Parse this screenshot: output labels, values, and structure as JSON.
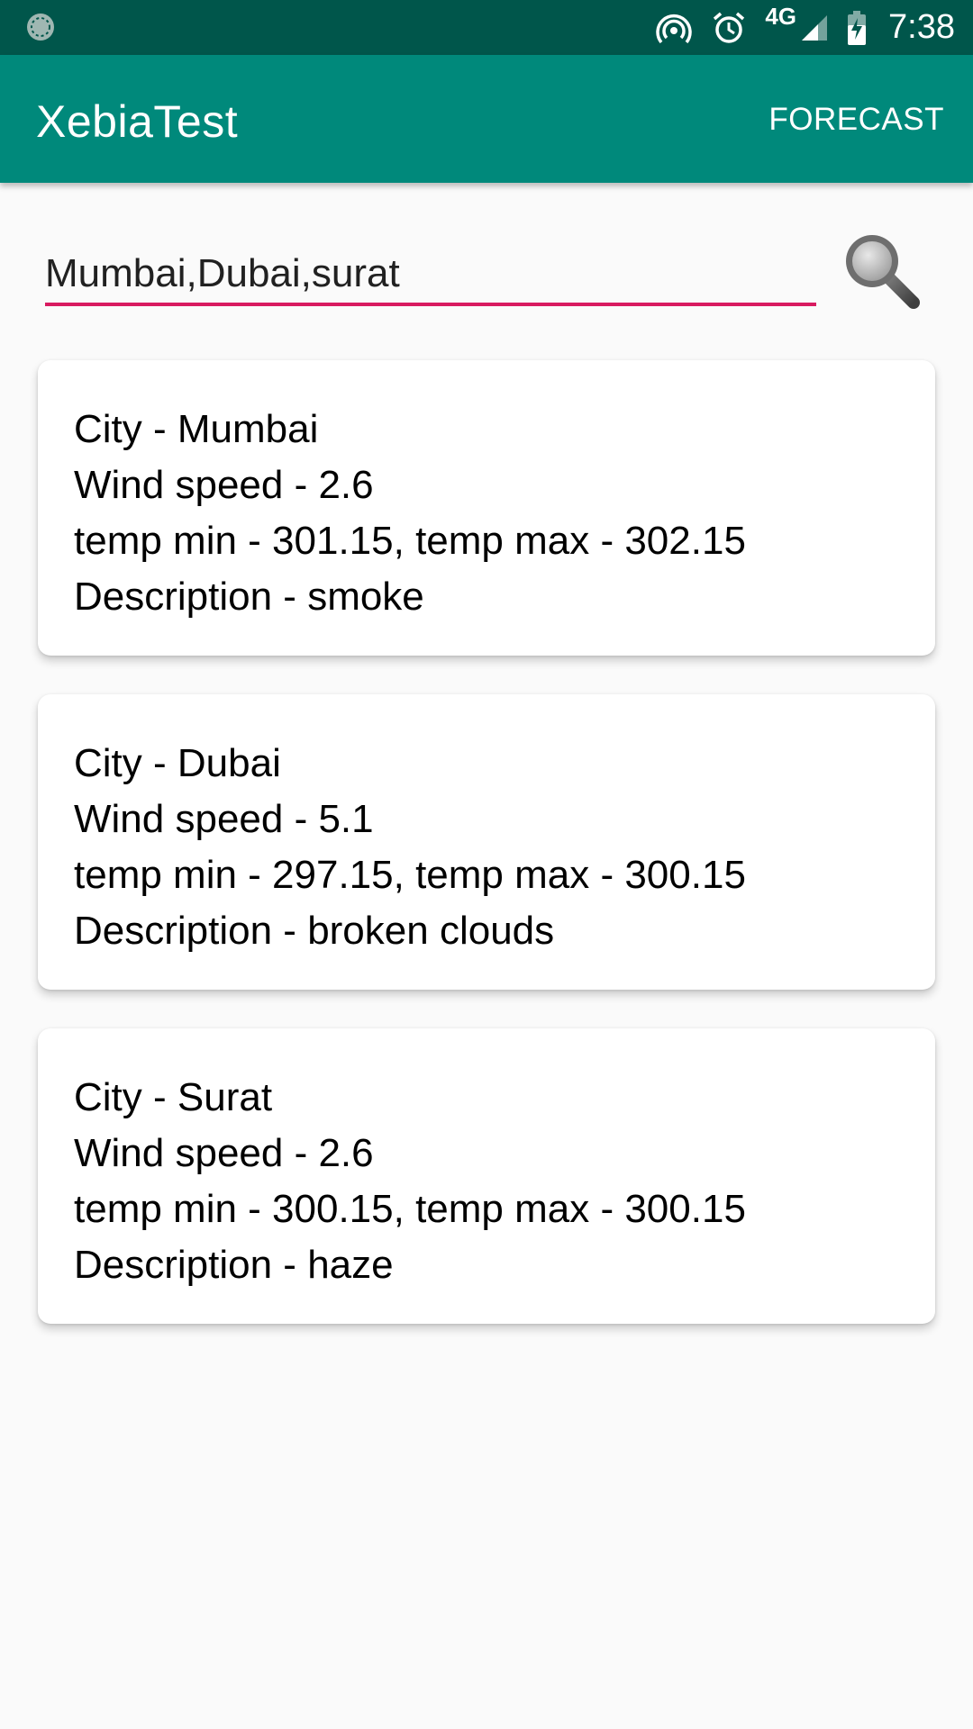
{
  "status_bar": {
    "network": "4G",
    "time": "7:38",
    "icons": [
      "sync-icon",
      "hotspot-icon",
      "alarm-icon",
      "signal-icon",
      "battery-charging-icon"
    ]
  },
  "app_bar": {
    "title": "XebiaTest",
    "action_label": "FORECAST"
  },
  "search": {
    "value": "Mumbai,Dubai,surat",
    "icon": "magnifier-icon"
  },
  "cards": [
    {
      "city": "City - Mumbai",
      "wind": "Wind speed - 2.6",
      "temp": "temp min - 301.15, temp max - 302.15",
      "description": "Description - smoke"
    },
    {
      "city": "City - Dubai",
      "wind": "Wind speed - 5.1",
      "temp": "temp min - 297.15, temp max - 300.15",
      "description": "Description - broken clouds"
    },
    {
      "city": "City - Surat",
      "wind": "Wind speed - 2.6",
      "temp": "temp min - 300.15, temp max - 300.15",
      "description": "Description - haze"
    }
  ],
  "colors": {
    "status_bar": "#00564b",
    "app_bar": "#00897b",
    "accent": "#d81b60",
    "background": "#fafafa"
  }
}
